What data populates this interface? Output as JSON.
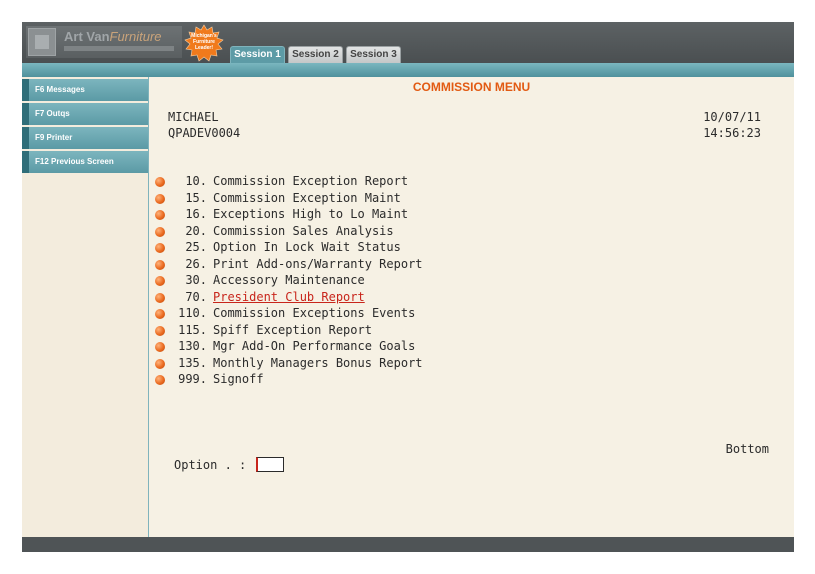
{
  "tabs": [
    {
      "label": "Session 1",
      "active": true
    },
    {
      "label": "Session 2",
      "active": false
    },
    {
      "label": "Session 3",
      "active": false
    }
  ],
  "badge": {
    "lines": [
      "Michigan's",
      "Furniture",
      "Leader!"
    ]
  },
  "logo": {
    "name": "Art Van",
    "name_alt": "Furniture"
  },
  "sidebar": {
    "items": [
      {
        "label": "F6 Messages"
      },
      {
        "label": "F7 Outqs"
      },
      {
        "label": "F9 Printer"
      },
      {
        "label": "F12 Previous Screen"
      }
    ]
  },
  "screen": {
    "title": "COMMISSION MENU",
    "user": "MICHAEL",
    "device": "QPADEV0004",
    "date": "10/07/11",
    "time": "14:56:23",
    "bottom": "Bottom",
    "option_label": "Option . :",
    "option_value": ""
  },
  "menu": [
    {
      "num": "10.",
      "label": "Commission Exception Report"
    },
    {
      "num": "15.",
      "label": "Commission Exception Maint"
    },
    {
      "num": "16.",
      "label": "Exceptions High to Lo Maint"
    },
    {
      "num": "20.",
      "label": "Commission Sales Analysis"
    },
    {
      "num": "25.",
      "label": "Option In Lock Wait Status"
    },
    {
      "num": "26.",
      "label": "Print Add-ons/Warranty Report"
    },
    {
      "num": "30.",
      "label": "Accessory Maintenance"
    },
    {
      "num": "70.",
      "label": "President Club Report",
      "highlighted": true
    },
    {
      "num": "110.",
      "label": "Commission Exceptions Events"
    },
    {
      "num": "115.",
      "label": "Spiff Exception Report"
    },
    {
      "num": "130.",
      "label": "Mgr Add-On Performance Goals"
    },
    {
      "num": "135.",
      "label": "Monthly Managers Bonus Report"
    },
    {
      "num": "999.",
      "label": "Signoff"
    }
  ],
  "colors": {
    "accent": "#e25a12",
    "teal": "#5d9ba6",
    "link": "#c8251b",
    "background": "#f6f1e4"
  }
}
